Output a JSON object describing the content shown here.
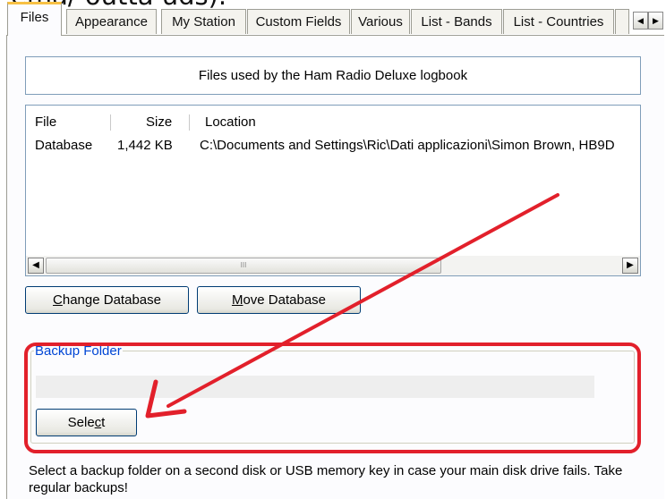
{
  "cut_text": "ema/ outta uds).",
  "tabs": [
    "Files",
    "Appearance",
    "My Station",
    "Custom Fields",
    "Various",
    "List - Bands",
    "List - Countries"
  ],
  "tab_scroll": {
    "left": "◀",
    "right": "▶"
  },
  "info_text": "Files used by the Ham Radio Deluxe logbook",
  "files_table": {
    "columns": [
      "File",
      "Size",
      "Location"
    ],
    "rows": [
      {
        "file": "Database",
        "size": "1,442 KB",
        "location": "C:\\Documents and Settings\\Ric\\Dati applicazioni\\Simon Brown, HB9D"
      }
    ]
  },
  "scrollbar": {
    "left": "◀",
    "right": "▶",
    "grip": "III"
  },
  "buttons": {
    "change_database_mnemonic": "C",
    "change_database_rest": "hange Database",
    "move_database_mnemonic": "M",
    "move_database_rest": "ove Database",
    "select_before": "Sele",
    "select_mnemonic": "c",
    "select_after": "t"
  },
  "backup_group_label": "Backup Folder",
  "backup_folder_value": "",
  "help_text": "Select a backup folder on a second disk or USB memory key in case your main disk drive fails.  Take regular backups!",
  "annotation_color": "#e2202b"
}
